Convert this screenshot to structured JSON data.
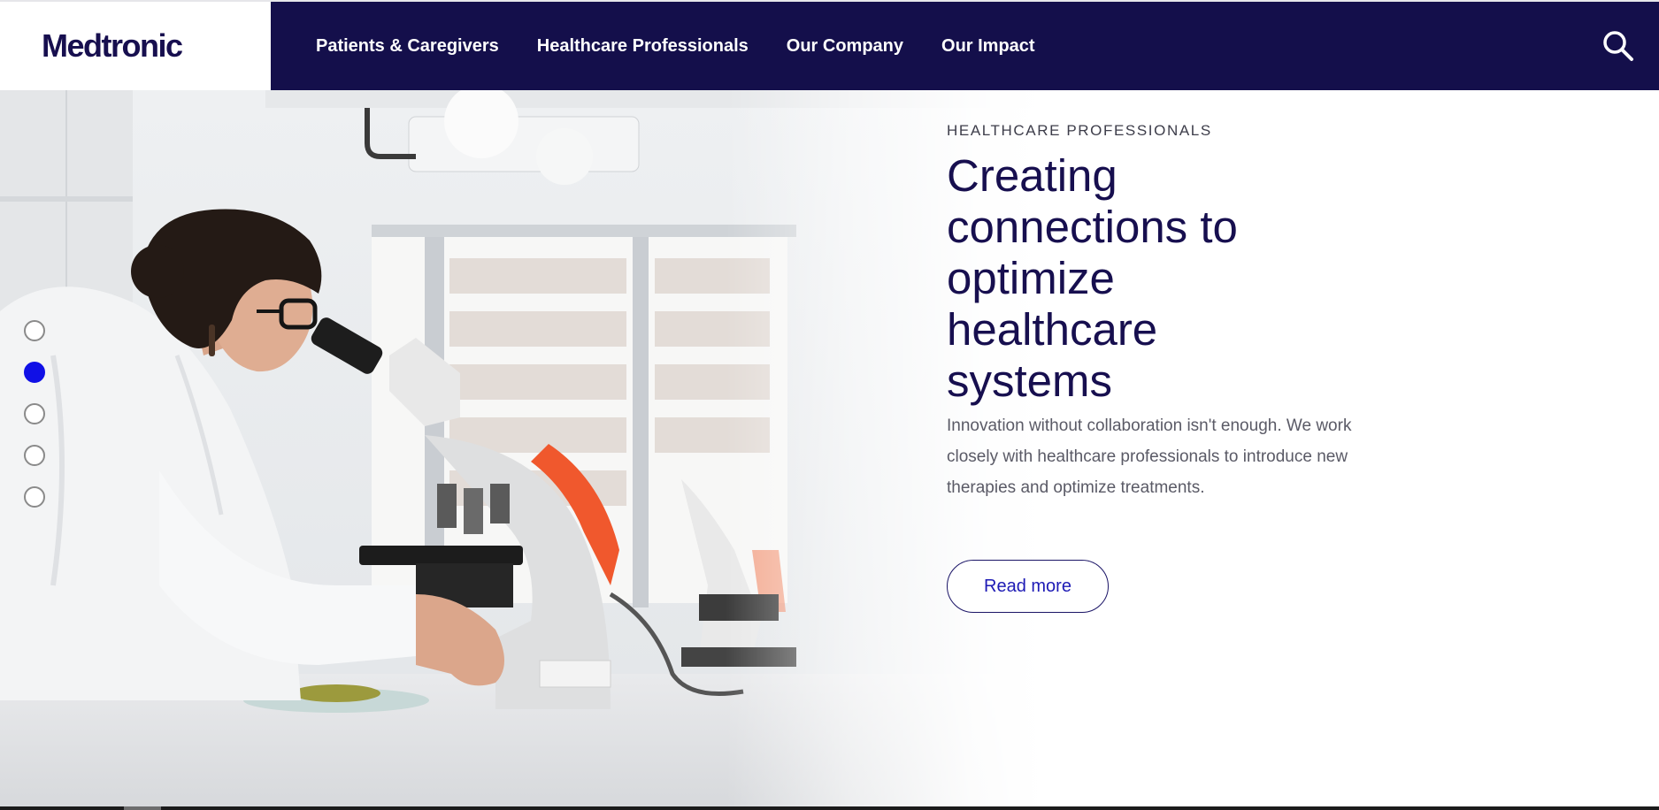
{
  "brand": {
    "logo_text": "Medtronic",
    "nav_color": "#140f4b",
    "accent": "#1010e6"
  },
  "nav": {
    "items": [
      {
        "label": "Patients & Caregivers"
      },
      {
        "label": "Healthcare Professionals"
      },
      {
        "label": "Our Company"
      },
      {
        "label": "Our Impact"
      }
    ],
    "search_icon": "search-icon"
  },
  "hero": {
    "eyebrow": "HEALTHCARE PROFESSIONALS",
    "headline": "Creating connections to optimize healthcare systems",
    "description": "Innovation without collaboration isn't enough. We work closely with healthcare professionals to introduce new therapies and optimize treatments.",
    "cta_label": "Read more",
    "slides_total": 5,
    "active_slide": 2
  }
}
